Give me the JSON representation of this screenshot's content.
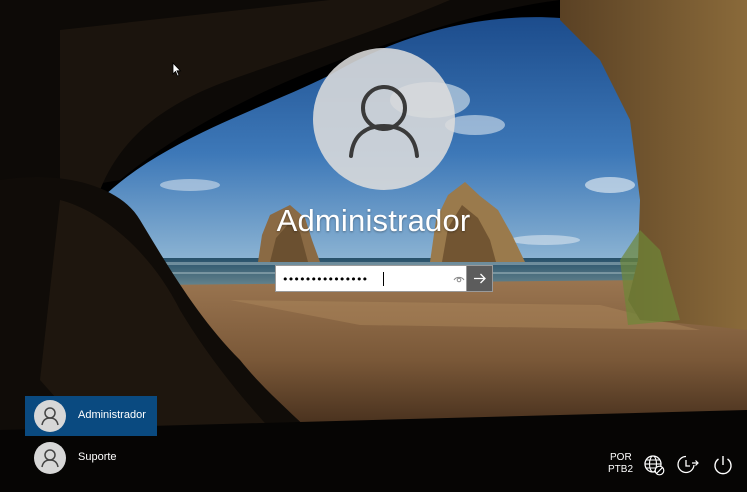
{
  "login": {
    "username": "Administrador",
    "password_masked": "•••••••••••••••"
  },
  "icons": {
    "avatar": "user-avatar-icon",
    "reveal": "eye-icon",
    "submit": "arrow-right-icon",
    "network": "network-globe-icon",
    "accessibility": "ease-of-access-icon",
    "power": "power-icon",
    "cursor": "mouse-pointer-icon"
  },
  "users": [
    {
      "name": "Administrador",
      "selected": true
    },
    {
      "name": "Suporte",
      "selected": false
    }
  ],
  "tray": {
    "language_line1": "POR",
    "language_line2": "PTB2"
  },
  "colors": {
    "selected_user_bg": "#0a4a80",
    "submit_bg": "#5c5c5c"
  }
}
